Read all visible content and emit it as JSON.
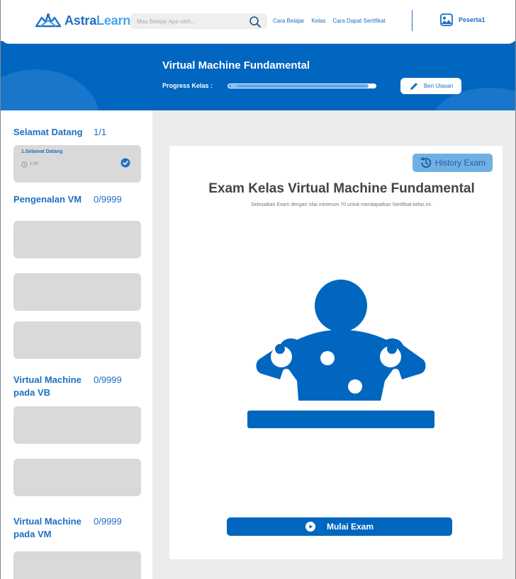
{
  "brand": {
    "name_part1": "Astra",
    "name_part2": "Learn"
  },
  "search": {
    "placeholder": "Mau Belajar Apa nihh..."
  },
  "nav": {
    "links": [
      "Cara Belajar",
      "Kelas",
      "Cara Dapat Sertifikat"
    ]
  },
  "profile": {
    "name": "Peserta1"
  },
  "hero": {
    "title": "Virtual Machine Fundamental",
    "progress_label": "Progress Kelas :",
    "progress_value": "95%",
    "progress_fraction": 0.95,
    "review_button": "Beri Ulasan"
  },
  "sidebar": {
    "sections": [
      {
        "title": "Selamat Datang",
        "count": "1/1"
      },
      {
        "title": "Pengenalan VM",
        "count": "0/9999"
      },
      {
        "title": "Virtual Machine pada VB",
        "count": "0/9999"
      },
      {
        "title": "Virtual Machine pada VM",
        "count": "0/9999"
      }
    ],
    "active_item": {
      "title": "1.Selamat Datang",
      "duration": "1:00",
      "completed": true
    }
  },
  "exam": {
    "history_button": "History Exam",
    "title": "Exam Kelas Virtual Machine Fundamental",
    "subtitle": "Selesaikan Exam dengan nilai minimum 70 untuk mendapatkan Sertifikat kelas ini.",
    "start_button": "Mulai Exam"
  },
  "icons": {
    "search": "search-icon",
    "profile": "image-icon",
    "review": "pencil-icon",
    "history": "history-icon",
    "clock": "clock-icon",
    "check": "check-circle-icon",
    "play": "play-icon"
  },
  "colors": {
    "primary": "#0066c0",
    "accent_light": "#72b0e2",
    "card": "#d9d9d9",
    "main_bg": "#ebebeb"
  }
}
